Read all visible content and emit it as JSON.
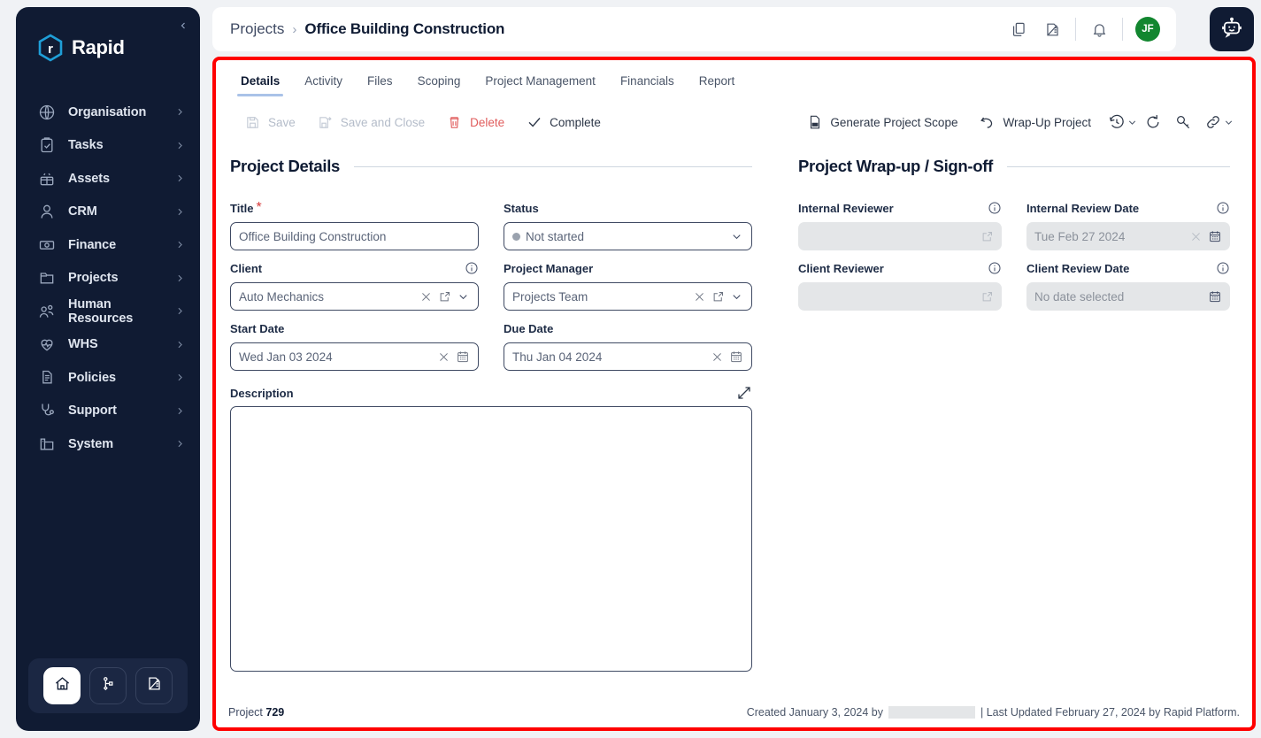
{
  "sidebar": {
    "brand": "Rapid",
    "collapse_icon": "chevron-left-icon",
    "items": [
      {
        "label": "Organisation",
        "icon": "globe-icon"
      },
      {
        "label": "Tasks",
        "icon": "clipboard-check-icon"
      },
      {
        "label": "Assets",
        "icon": "assets-box-icon"
      },
      {
        "label": "CRM",
        "icon": "person-icon"
      },
      {
        "label": "Finance",
        "icon": "money-icon"
      },
      {
        "label": "Projects",
        "icon": "folder-icon"
      },
      {
        "label": "Human Resources",
        "icon": "people-icon"
      },
      {
        "label": "WHS",
        "icon": "heart-pulse-icon"
      },
      {
        "label": "Policies",
        "icon": "document-icon"
      },
      {
        "label": "Support",
        "icon": "stethoscope-icon"
      },
      {
        "label": "System",
        "icon": "server-icon"
      }
    ],
    "bottom_buttons": [
      {
        "icon": "home-icon",
        "active": true
      },
      {
        "icon": "sitemap-icon",
        "active": false
      },
      {
        "icon": "ruler-document-icon",
        "active": false
      }
    ]
  },
  "header": {
    "breadcrumb_root": "Projects",
    "breadcrumb_separator": "›",
    "breadcrumb_current": "Office Building Construction",
    "icons": [
      {
        "name": "copy-pages-icon"
      },
      {
        "name": "ruler-measure-icon"
      },
      {
        "name": "bell-icon"
      }
    ],
    "avatar_initials": "JF",
    "avatar_color": "#12862f",
    "chatbot_icon": "robot-icon"
  },
  "tabs": [
    {
      "label": "Details",
      "active": true
    },
    {
      "label": "Activity",
      "active": false
    },
    {
      "label": "Files",
      "active": false
    },
    {
      "label": "Scoping",
      "active": false
    },
    {
      "label": "Project Management",
      "active": false
    },
    {
      "label": "Financials",
      "active": false
    },
    {
      "label": "Report",
      "active": false
    }
  ],
  "toolbar": {
    "save_label": "Save",
    "save_and_close_label": "Save and Close",
    "delete_label": "Delete",
    "complete_label": "Complete",
    "generate_scope_label": "Generate Project Scope",
    "wrap_up_label": "Wrap-Up Project",
    "delete_color": "#e05c5c",
    "disabled_color": "#b4bcc9",
    "right_icons": [
      {
        "name": "history-clock-icon",
        "has_chevron": true
      },
      {
        "name": "refresh-icon",
        "has_chevron": false
      },
      {
        "name": "key-icon",
        "has_chevron": false
      },
      {
        "name": "link-chain-icon",
        "has_chevron": true
      }
    ]
  },
  "project_details": {
    "section_title": "Project Details",
    "title": {
      "label": "Title",
      "required": true,
      "value": "Office Building Construction"
    },
    "status": {
      "label": "Status",
      "value": "Not started",
      "dot_color": "#9aa2ae"
    },
    "client": {
      "label": "Client",
      "value": "Auto Mechanics",
      "has_info": true
    },
    "project_manager": {
      "label": "Project Manager",
      "value": "Projects Team",
      "has_info": false
    },
    "start_date": {
      "label": "Start Date",
      "value": "Wed Jan 03 2024"
    },
    "due_date": {
      "label": "Due Date",
      "value": "Thu Jan 04 2024"
    },
    "description": {
      "label": "Description",
      "value": "",
      "expand_icon": "expand-diagonal-icon"
    }
  },
  "wrap_up": {
    "section_title": "Project Wrap-up / Sign-off",
    "internal_reviewer": {
      "label": "Internal Reviewer",
      "value": "",
      "disabled": true
    },
    "internal_review_date": {
      "label": "Internal Review Date",
      "value": "Tue Feb 27 2024",
      "disabled": true
    },
    "client_reviewer": {
      "label": "Client Reviewer",
      "value": "",
      "disabled": true
    },
    "client_review_date": {
      "label": "Client Review Date",
      "value": "No date selected",
      "disabled": true
    }
  },
  "footer": {
    "record_label": "Project",
    "record_number": "729",
    "created_text": "Created January 3, 2024 by",
    "created_by_redacted": true,
    "updated_text": "| Last Updated February 27, 2024 by Rapid Platform."
  },
  "highlight": {
    "border_color": "#ff0000"
  }
}
